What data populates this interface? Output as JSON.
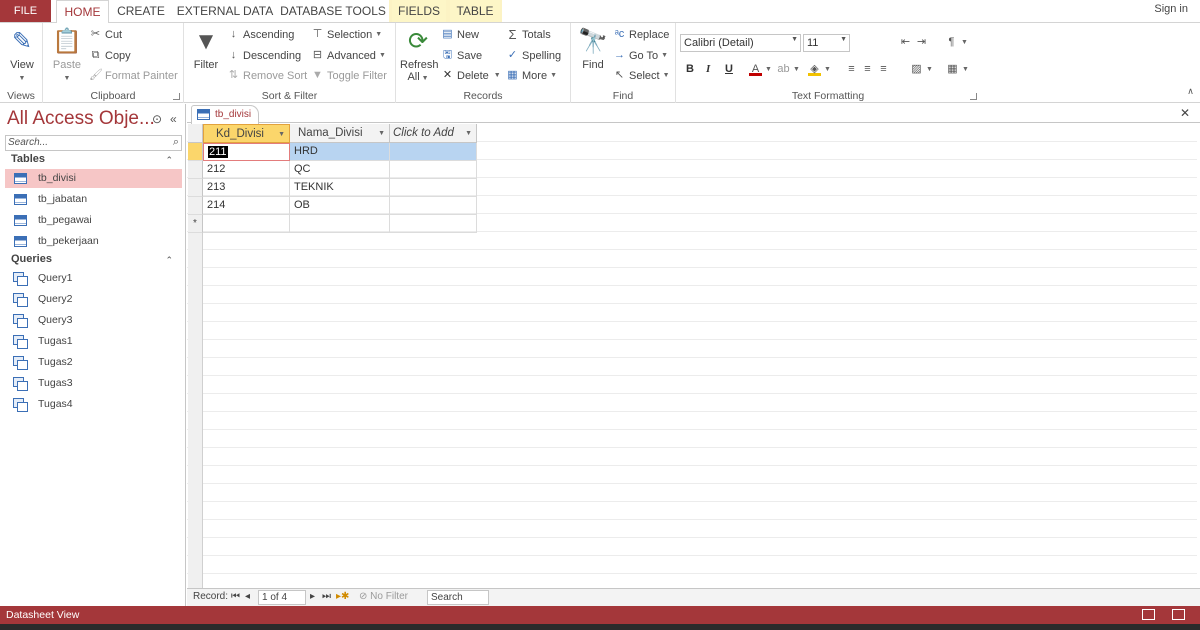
{
  "ribbon_tabs": {
    "file": "FILE",
    "home": "HOME",
    "create": "CREATE",
    "external_data": "EXTERNAL DATA",
    "database_tools": "DATABASE TOOLS",
    "fields": "FIELDS",
    "table": "TABLE",
    "sign_in": "Sign in"
  },
  "views": {
    "view": "View",
    "label": "Views"
  },
  "clipboard": {
    "paste": "Paste",
    "cut": "Cut",
    "copy": "Copy",
    "format_painter": "Format Painter",
    "label": "Clipboard"
  },
  "sort_filter": {
    "filter": "Filter",
    "ascending": "Ascending",
    "descending": "Descending",
    "remove_sort": "Remove Sort",
    "selection": "Selection",
    "advanced": "Advanced",
    "toggle_filter": "Toggle Filter",
    "label": "Sort & Filter"
  },
  "records": {
    "refresh": "Refresh",
    "refresh_all": "All",
    "new": "New",
    "save": "Save",
    "delete": "Delete",
    "totals": "Totals",
    "spelling": "Spelling",
    "more": "More",
    "label": "Records"
  },
  "find": {
    "find": "Find",
    "replace": "Replace",
    "go_to": "Go To",
    "select": "Select",
    "label": "Find"
  },
  "text_formatting": {
    "font": "Calibri (Detail)",
    "size": "11",
    "bold": "B",
    "italic": "I",
    "underline": "U",
    "label": "Text Formatting"
  },
  "nav_pane": {
    "title": "All Access Obje...",
    "search_placeholder": "Search...",
    "tables_header": "Tables",
    "tables": [
      "tb_divisi",
      "tb_jabatan",
      "tb_pegawai",
      "tb_pekerjaan"
    ],
    "queries_header": "Queries",
    "queries": [
      "Query1",
      "Query2",
      "Query3",
      "Tugas1",
      "Tugas2",
      "Tugas3",
      "Tugas4"
    ]
  },
  "document": {
    "tab": "tb_divisi",
    "columns": [
      "Kd_Divisi",
      "Nama_Divisi",
      "Click to Add"
    ],
    "rows": [
      [
        "211",
        "HRD"
      ],
      [
        "212",
        "QC"
      ],
      [
        "213",
        "TEKNIK"
      ],
      [
        "214",
        "OB"
      ]
    ],
    "new_row_marker": "*"
  },
  "record_nav": {
    "label": "Record:",
    "position": "1 of 4",
    "no_filter": "No Filter",
    "search": "Search"
  },
  "status_bar": {
    "text": "Datasheet View"
  },
  "colors": {
    "accent": "#a4373a",
    "active_header": "#fbd66b",
    "selected_row": "#b8d4f1"
  }
}
